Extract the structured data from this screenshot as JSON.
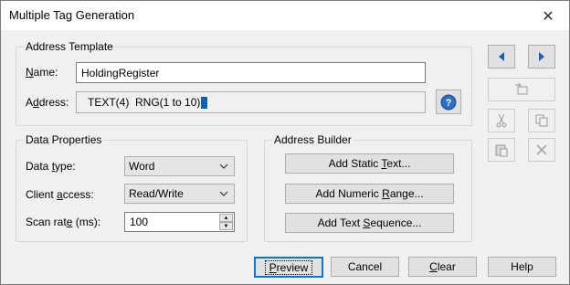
{
  "window": {
    "title": "Multiple Tag Generation"
  },
  "address_template": {
    "group_title": "Address Template",
    "name_label": "Name:",
    "name_value": "HoldingRegister",
    "address_label": "Address:",
    "address_value": "TEXT(4)  RNG(1 to 10)"
  },
  "data_properties": {
    "group_title": "Data Properties",
    "data_type_label": "Data type:",
    "data_type_value": "Word",
    "client_access_label": "Client access:",
    "client_access_value": "Read/Write",
    "scan_rate_label": "Scan rate (ms):",
    "scan_rate_value": "100"
  },
  "address_builder": {
    "group_title": "Address Builder",
    "static_text_label": "Add Static Text...",
    "numeric_range_label": "Add Numeric Range...",
    "text_sequence_label": "Add Text Sequence..."
  },
  "footer": {
    "preview_label": "Preview",
    "cancel_label": "Cancel",
    "clear_label": "Clear",
    "help_label": "Help"
  },
  "side_buttons": {
    "icons": [
      "arrow-left-icon",
      "arrow-right-icon",
      "insert-icon",
      "cut-icon",
      "copy-icon",
      "paste-icon",
      "delete-icon"
    ]
  },
  "colors": {
    "accent": "#0078d7",
    "arrow_blue": "#1a5fb4",
    "help_blue": "#2b6cc4"
  }
}
